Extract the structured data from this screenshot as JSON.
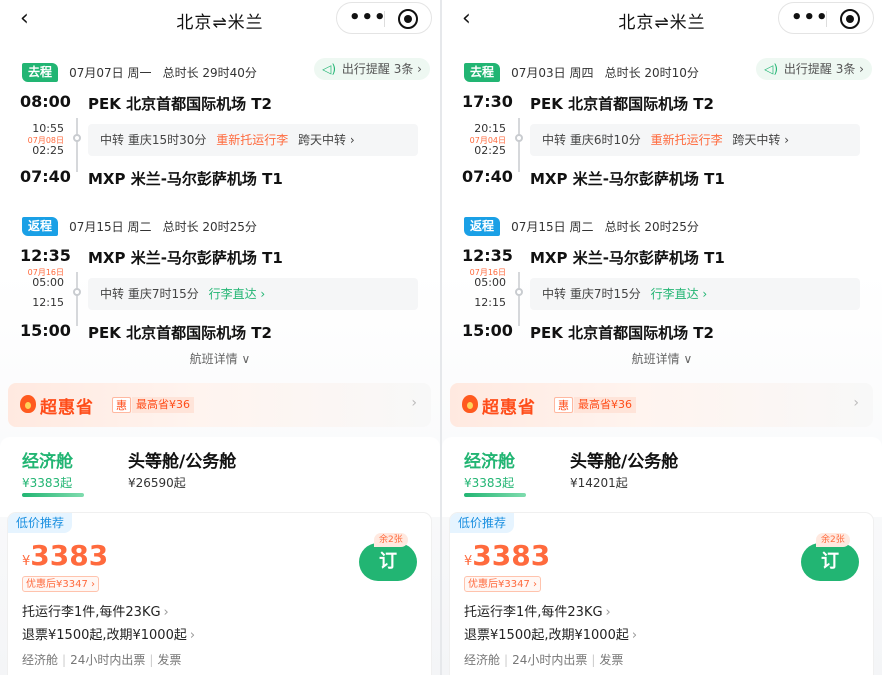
{
  "common": {
    "nav_title": "北京⇌米兰",
    "back_icon": "‹",
    "more_icon": "•••",
    "detail_label": "航班详情",
    "detail_chevron": "∨",
    "reminder_icon": "speaker-icon",
    "promo": {
      "title": "超惠省",
      "hui": "惠",
      "text": "最高省¥36",
      "chevron": "›"
    },
    "cabin_economy": "经济舱",
    "cabin_first": "头等舱/公务舱",
    "low_price_tag": "低价推荐",
    "currency": "¥",
    "fare_price": "3383",
    "after_discount": "优惠后¥3347 ›",
    "remaining": "余2张",
    "book_label": "订",
    "baggage": "托运行李1件,每件23KG",
    "refund": "退票¥1500起,改期¥1000起",
    "chev": "›",
    "footer_tags": [
      "经济舱",
      "24小时内出票",
      "发票"
    ],
    "colors": {
      "green": "#22b573",
      "blue": "#1aa0e6",
      "orange": "#ff6a3d"
    }
  },
  "panels": [
    {
      "outbound": {
        "tag": "去程",
        "date": "07月07日 周一",
        "duration": "总时长 29时40分",
        "reminder": "出行提醒 3条 ›",
        "dep_time": "08:00",
        "dep_airport": "PEK 北京首都国际机场 T2",
        "transfer_arr": "10:55",
        "transfer_next_day": "07月08日",
        "transfer_dep": "02:25",
        "transfer_text": "中转  重庆15时30分",
        "transfer_highlight": "重新托运行李",
        "transfer_note": "跨天中转 ›",
        "arr_time": "07:40",
        "arr_airport": "MXP 米兰-马尔彭萨机场 T1"
      },
      "return": {
        "tag": "返程",
        "date": "07月15日 周二",
        "duration": "总时长 20时25分",
        "dep_time": "12:35",
        "dep_airport": "MXP 米兰-马尔彭萨机场 T1",
        "transfer_next_day": "07月16日",
        "transfer_arr": "05:00",
        "transfer_dep": "12:15",
        "transfer_text": "中转  重庆7时15分",
        "transfer_highlight": "行李直达 ›",
        "arr_time": "15:00",
        "arr_airport": "PEK 北京首都国际机场 T2"
      },
      "economy_price": "¥3383起",
      "first_price": "¥26590起"
    },
    {
      "outbound": {
        "tag": "去程",
        "date": "07月03日 周四",
        "duration": "总时长 20时10分",
        "reminder": "出行提醒 3条 ›",
        "dep_time": "17:30",
        "dep_airport": "PEK 北京首都国际机场 T2",
        "transfer_arr": "20:15",
        "transfer_next_day": "07月04日",
        "transfer_dep": "02:25",
        "transfer_text": "中转  重庆6时10分",
        "transfer_highlight": "重新托运行李",
        "transfer_note": "跨天中转 ›",
        "arr_time": "07:40",
        "arr_airport": "MXP 米兰-马尔彭萨机场 T1"
      },
      "return": {
        "tag": "返程",
        "date": "07月15日 周二",
        "duration": "总时长 20时25分",
        "dep_time": "12:35",
        "dep_airport": "MXP 米兰-马尔彭萨机场 T1",
        "transfer_next_day": "07月16日",
        "transfer_arr": "05:00",
        "transfer_dep": "12:15",
        "transfer_text": "中转  重庆7时15分",
        "transfer_highlight": "行李直达 ›",
        "arr_time": "15:00",
        "arr_airport": "PEK 北京首都国际机场 T2"
      },
      "economy_price": "¥3383起",
      "first_price": "¥14201起"
    }
  ]
}
